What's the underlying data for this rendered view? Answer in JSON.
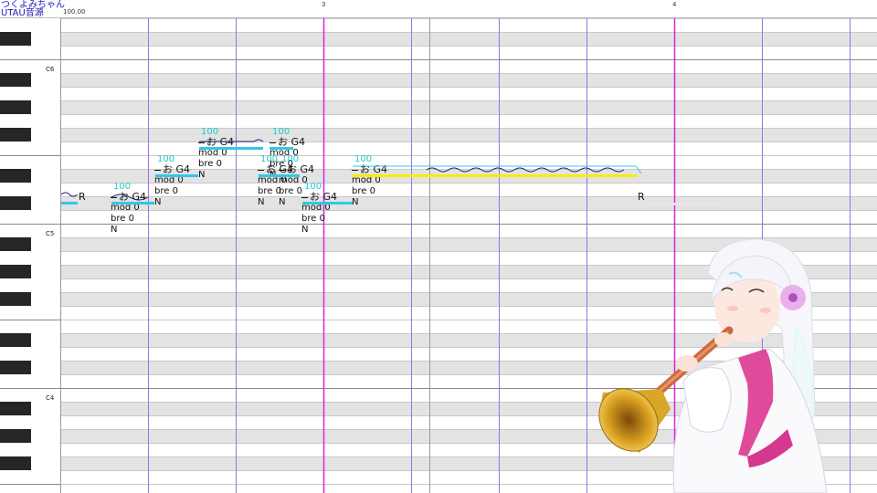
{
  "header": {
    "singer_name": "つくよみちゃん",
    "voicebank": "UTAU音源",
    "tempo": "100.00",
    "measures": [
      "3",
      "4"
    ]
  },
  "keyboard": {
    "octave_labels": [
      "C6",
      "C5",
      "C4"
    ]
  },
  "notes": [
    {
      "lyric": "R",
      "velocity": "",
      "params": []
    },
    {
      "lyric": "お",
      "pitch": "G4",
      "velocity": "100",
      "params": [
        "mod 0",
        "bre 0",
        "N"
      ]
    },
    {
      "lyric": "お",
      "pitch": "G4",
      "velocity": "100",
      "params": [
        "mod 0",
        "bre 0",
        "N"
      ]
    },
    {
      "lyric": "お",
      "pitch": "G4",
      "velocity": "100",
      "params": [
        "mod 0",
        "bre 0",
        "N"
      ]
    },
    {
      "lyric": "お",
      "pitch": "G4",
      "velocity": "100",
      "params": [
        "mod 0",
        "bre 0",
        "N"
      ]
    },
    {
      "lyric": "お",
      "pitch": "G4",
      "velocity": "100",
      "params": [
        "mod 0",
        "bre 0",
        "N"
      ]
    },
    {
      "lyric": "お",
      "pitch": "G4",
      "velocity": "100",
      "params": [
        "mod 0",
        "bre 0",
        "N"
      ]
    },
    {
      "lyric": "お",
      "pitch": "G4",
      "velocity": "100",
      "params": [
        "mod 0",
        "bre 0",
        "N"
      ]
    },
    {
      "lyric": "お",
      "pitch": "G4",
      "velocity": "100",
      "params": [
        "mod 0",
        "bre 0",
        "N"
      ]
    },
    {
      "lyric": "R",
      "velocity": "",
      "params": []
    }
  ],
  "colors": {
    "note_bar": "#30c8e8",
    "selected_note": "#f0f000",
    "beat_line": "#a070e8",
    "playhead": "#e020e0",
    "velocity": "#20c8c8"
  },
  "icons": [
    "character-illustration"
  ]
}
